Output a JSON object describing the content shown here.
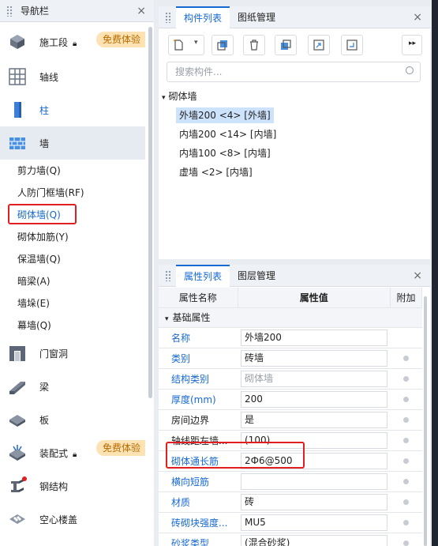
{
  "nav": {
    "title": "导航栏",
    "items": [
      {
        "label": "施工段",
        "badge": "免费体验",
        "icon": "construction-stage-icon"
      },
      {
        "label": "轴线",
        "icon": "axis-grid-icon"
      },
      {
        "label": "柱",
        "icon": "column-icon"
      },
      {
        "label": "墙",
        "icon": "wall-icon"
      }
    ],
    "sub": [
      "剪力墙(Q)",
      "人防门框墙(RF)",
      "砌体墙(Q)",
      "砌体加筋(Y)",
      "保温墙(Q)",
      "暗梁(A)",
      "墙垛(E)",
      "幕墙(Q)"
    ],
    "items2": [
      {
        "label": "门窗洞",
        "icon": "door-window-icon"
      },
      {
        "label": "梁",
        "icon": "beam-icon"
      },
      {
        "label": "板",
        "icon": "slab-icon"
      },
      {
        "label": "装配式",
        "badge": "免费体验",
        "icon": "prefab-icon"
      },
      {
        "label": "钢结构",
        "icon": "steel-structure-icon"
      },
      {
        "label": "空心楼盖",
        "icon": "hollow-floor-icon"
      }
    ]
  },
  "comp": {
    "tabs": [
      "构件列表",
      "图纸管理"
    ],
    "search_placeholder": "搜索构件...",
    "group": "砌体墙",
    "list": [
      "外墙200 <4> [外墙]",
      "内墙200 <14> [内墙]",
      "内墙100 <8> [内墙]",
      "虚墙 <2> [内墙]"
    ]
  },
  "props": {
    "tabs": [
      "属性列表",
      "图层管理"
    ],
    "cols": [
      "属性名称",
      "属性值",
      "附加"
    ],
    "group": "基础属性",
    "rows": [
      {
        "name": "名称",
        "value": "外墙200"
      },
      {
        "name": "类别",
        "value": "砖墙",
        "dot": true
      },
      {
        "name": "结构类别",
        "value": "砌体墙",
        "dot": true
      },
      {
        "name": "厚度(mm)",
        "value": "200",
        "dot": true
      },
      {
        "name": "房间边界",
        "value": "是",
        "dot": true
      },
      {
        "name": "轴线距左墙...",
        "value": "(100)",
        "dot": true
      },
      {
        "name": "砌体通长筋",
        "value": "2Ф6@500",
        "dot": true
      },
      {
        "name": "横向短筋",
        "value": "",
        "dot": true
      },
      {
        "name": "材质",
        "value": "砖",
        "dot": true
      },
      {
        "name": "砖砌块强度...",
        "value": "MU5",
        "dot": true
      },
      {
        "name": "砂浆类型",
        "value": "(混合砂浆)",
        "dot": true
      }
    ]
  }
}
